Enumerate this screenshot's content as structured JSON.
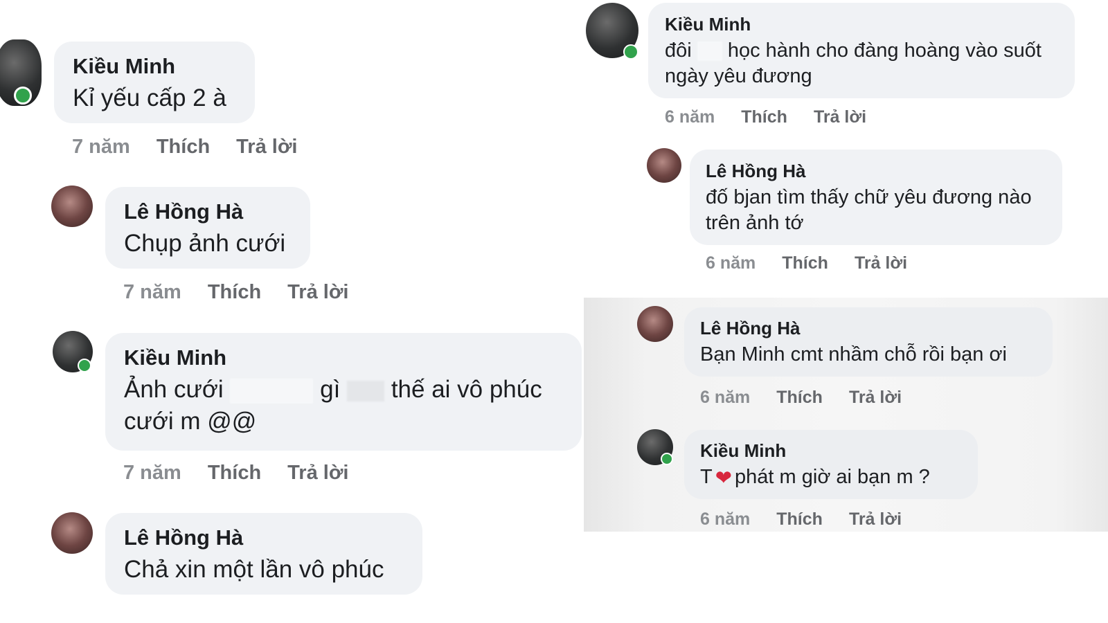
{
  "left_column": [
    {
      "author": "Kiều Minh",
      "text": "Kỉ yếu cấp 2 à",
      "time": "7 năm",
      "like": "Thích",
      "reply": "Trả lời"
    },
    {
      "author": "Lê Hồng Hà",
      "text": "Chụp ảnh cưới",
      "time": "7 năm",
      "like": "Thích",
      "reply": "Trả lời"
    },
    {
      "author": "Kiều Minh",
      "text_a": "Ảnh cưới",
      "text_b": "gì",
      "text_c": "thế ai vô phúc",
      "text_d": "cưới m @@",
      "time": "7 năm",
      "like": "Thích",
      "reply": "Trả lời"
    },
    {
      "author": "Lê Hồng Hà",
      "text": "Chả xin một lần vô phúc",
      "time": "",
      "like": "",
      "reply": ""
    }
  ],
  "right_column": [
    {
      "author": "Kiều Minh",
      "text_a": "đôi",
      "text_b": "học hành cho đàng hoàng vào suốt",
      "text_c": "ngày yêu đương",
      "time": "6 năm",
      "like": "Thích",
      "reply": "Trả lời"
    },
    {
      "author": "Lê Hồng Hà",
      "text_a": "đố bjan tìm thấy chữ yêu đương nào",
      "text_b": "trên ảnh tớ",
      "time": "6 năm",
      "like": "Thích",
      "reply": "Trả lời"
    },
    {
      "author": "Lê Hồng Hà",
      "text": "Bạn Minh cmt nhầm chỗ rồi bạn ơi",
      "time": "6 năm",
      "like": "Thích",
      "reply": "Trả lời"
    },
    {
      "author": "Kiều Minh",
      "text_a": "T",
      "text_b": "phát m giờ ai bạn m ?",
      "time": "6 năm",
      "like": "Thích",
      "reply": "Trả lời"
    }
  ],
  "colors": {
    "bubble": "#f0f2f5",
    "online": "#31a24c",
    "action_text": "#65676b",
    "heart": "#d7263d"
  },
  "icons": [
    "online-status-icon",
    "heart-icon"
  ]
}
